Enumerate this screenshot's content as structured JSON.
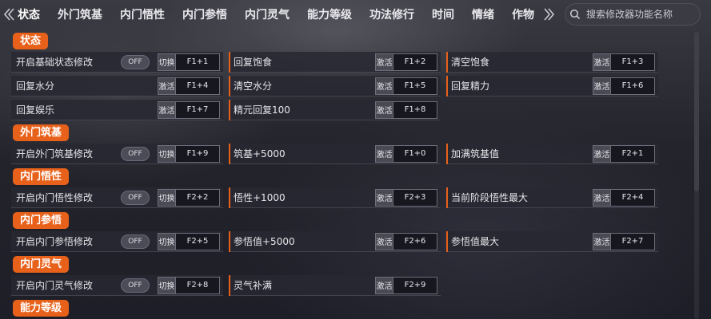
{
  "nav": {
    "prev_icon": "chevron-left-icon",
    "next_icon": "chevron-right-icon",
    "tabs": [
      "状态",
      "外门筑基",
      "内门悟性",
      "内门参悟",
      "内门灵气",
      "能力等级",
      "功法修行",
      "时间",
      "情绪",
      "作物"
    ],
    "active_tab": "状态",
    "search_placeholder": "搜索修改器功能名称"
  },
  "colors": {
    "accent": "#e8611a",
    "background": "#24242c"
  },
  "sections": [
    {
      "title": "状态",
      "rows": [
        [
          {
            "label": "开启基础状态修改",
            "toggle": "OFF",
            "button": "切换",
            "hotkey": "F1+1"
          },
          {
            "label": "回复饱食",
            "button": "激活",
            "hotkey": "F1+2"
          },
          {
            "label": "清空饱食",
            "button": "激活",
            "hotkey": "F1+3"
          }
        ],
        [
          {
            "label": "回复水分",
            "button": "激活",
            "hotkey": "F1+4"
          },
          {
            "label": "清空水分",
            "button": "激活",
            "hotkey": "F1+5"
          },
          {
            "label": "回复精力",
            "button": "激活",
            "hotkey": "F1+6"
          }
        ],
        [
          {
            "label": "回复娱乐",
            "button": "激活",
            "hotkey": "F1+7"
          },
          {
            "label": "精元回复100",
            "button": "激活",
            "hotkey": "F1+8"
          }
        ]
      ]
    },
    {
      "title": "外门筑基",
      "rows": [
        [
          {
            "label": "开启外门筑基修改",
            "toggle": "OFF",
            "button": "切换",
            "hotkey": "F1+9"
          },
          {
            "label": "筑基+5000",
            "button": "激活",
            "hotkey": "F1+0"
          },
          {
            "label": "加满筑基值",
            "button": "激活",
            "hotkey": "F2+1"
          }
        ]
      ]
    },
    {
      "title": "内门悟性",
      "rows": [
        [
          {
            "label": "开启内门悟性修改",
            "toggle": "OFF",
            "button": "切换",
            "hotkey": "F2+2"
          },
          {
            "label": "悟性+1000",
            "button": "激活",
            "hotkey": "F2+3"
          },
          {
            "label": "当前阶段悟性最大",
            "button": "激活",
            "hotkey": "F2+4"
          }
        ]
      ]
    },
    {
      "title": "内门参悟",
      "rows": [
        [
          {
            "label": "开启内门参悟修改",
            "toggle": "OFF",
            "button": "切换",
            "hotkey": "F2+5"
          },
          {
            "label": "参悟值+5000",
            "button": "激活",
            "hotkey": "F2+6"
          },
          {
            "label": "参悟值最大",
            "button": "激活",
            "hotkey": "F2+7"
          }
        ]
      ]
    },
    {
      "title": "内门灵气",
      "rows": [
        [
          {
            "label": "开启内门灵气修改",
            "toggle": "OFF",
            "button": "切换",
            "hotkey": "F2+8"
          },
          {
            "label": "灵气补满",
            "button": "激活",
            "hotkey": "F2+9"
          }
        ]
      ]
    },
    {
      "title": "能力等级",
      "rows": []
    }
  ]
}
